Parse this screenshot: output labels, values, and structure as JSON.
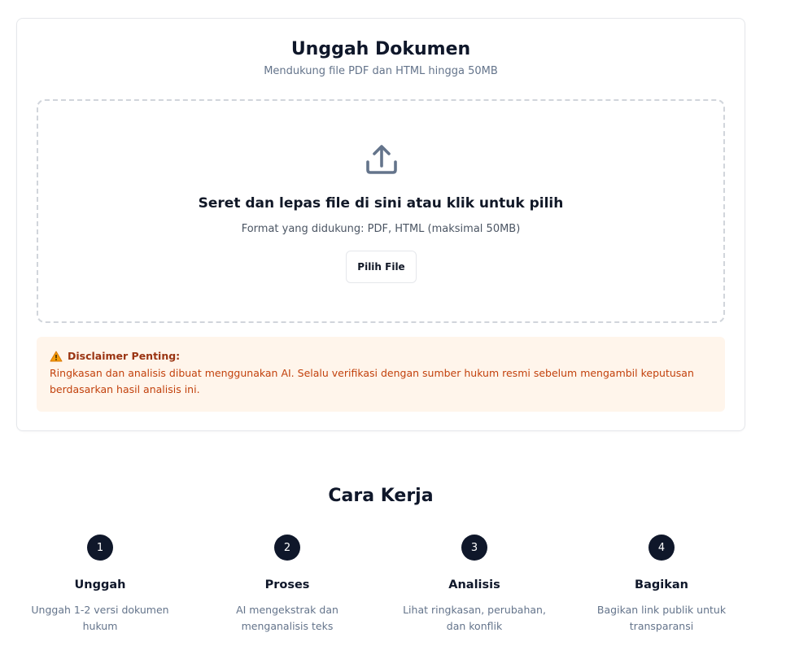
{
  "upload": {
    "title": "Unggah Dokumen",
    "subtitle": "Mendukung file PDF dan HTML hingga 50MB",
    "dropzone": {
      "icon": "upload-icon",
      "instruction": "Seret dan lepas file di sini atau klik untuk pilih",
      "formats": "Format yang didukung: PDF, HTML (maksimal 50MB)",
      "button_label": "Pilih File"
    },
    "disclaimer": {
      "icon": "warning-icon",
      "title": "Disclaimer Penting:",
      "body": "Ringkasan dan analisis dibuat menggunakan AI. Selalu verifikasi dengan sumber hukum resmi sebelum mengambil keputusan berdasarkan hasil analisis ini."
    }
  },
  "how_it_works": {
    "title": "Cara Kerja",
    "steps": [
      {
        "number": "1",
        "title": "Unggah",
        "description": "Unggah 1-2 versi dokumen hukum"
      },
      {
        "number": "2",
        "title": "Proses",
        "description": "AI mengekstrak dan menganalisis teks"
      },
      {
        "number": "3",
        "title": "Analisis",
        "description": "Lihat ringkasan, perubahan, dan konflik"
      },
      {
        "number": "4",
        "title": "Bagikan",
        "description": "Bagikan link publik untuk transparansi"
      }
    ]
  },
  "colors": {
    "primary_dark": "#0f172a",
    "muted_text": "#64748b",
    "disclaimer_bg": "#fff5eb",
    "disclaimer_text": "#c2410c",
    "dashed_border": "#d1d5db"
  }
}
